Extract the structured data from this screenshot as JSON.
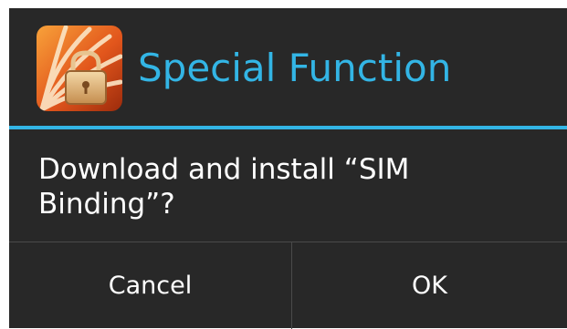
{
  "dialog": {
    "app_icon": "orange-fan-padlock-icon",
    "title": "Special Function",
    "message": "Download and install “SIM Binding”?",
    "buttons": {
      "cancel_label": "Cancel",
      "ok_label": "OK"
    }
  },
  "colors": {
    "accent": "#33b5e5",
    "background": "#282828",
    "text": "#ffffff",
    "divider": "#4a4a4a"
  }
}
